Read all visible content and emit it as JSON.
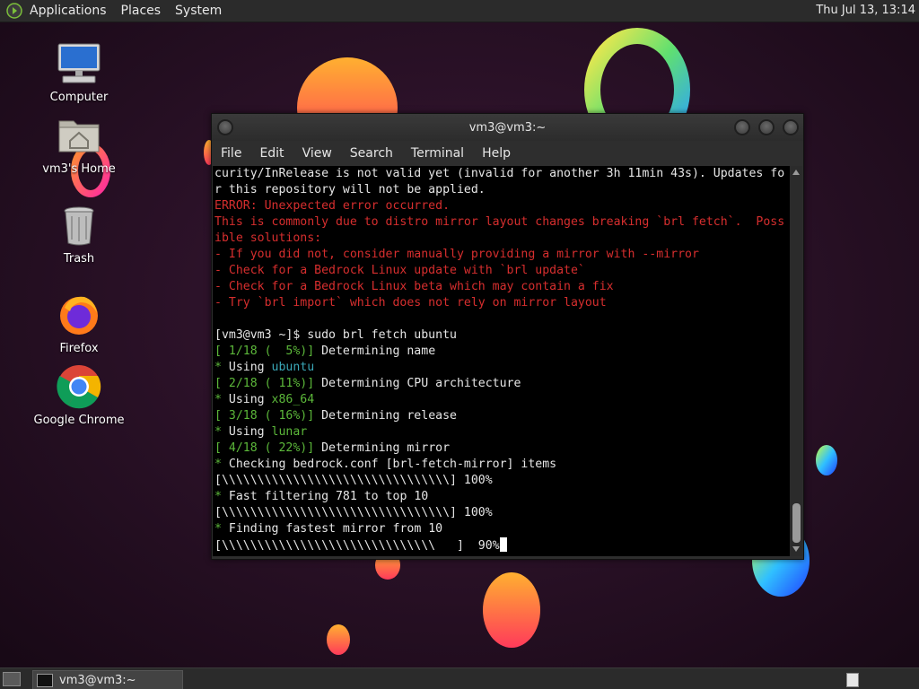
{
  "top_panel": {
    "menus": [
      "Applications",
      "Places",
      "System"
    ],
    "clock": "Thu Jul 13, 13:14"
  },
  "desktop": {
    "icons": [
      {
        "label": "Computer",
        "icon": "computer-icon"
      },
      {
        "label": "vm3's Home",
        "icon": "home-folder-icon"
      },
      {
        "label": "Trash",
        "icon": "trash-icon"
      },
      {
        "label": "Firefox",
        "icon": "firefox-icon"
      },
      {
        "label": "Google Chrome",
        "icon": "chrome-icon"
      }
    ]
  },
  "window": {
    "title": "vm3@vm3:~",
    "menus": [
      "File",
      "Edit",
      "View",
      "Search",
      "Terminal",
      "Help"
    ]
  },
  "terminal": {
    "lines": [
      [
        {
          "t": "curity/InRelease is not valid yet (invalid for another 3h 11min 43s). Updates fo",
          "c": ""
        }
      ],
      [
        {
          "t": "r this repository will not be applied.",
          "c": ""
        }
      ],
      [
        {
          "t": "ERROR: Unexpected error occurred.",
          "c": "red"
        }
      ],
      [
        {
          "t": "This is commonly due to distro mirror layout changes breaking `brl fetch`.  Poss",
          "c": "red"
        }
      ],
      [
        {
          "t": "ible solutions:",
          "c": "red"
        }
      ],
      [
        {
          "t": "- If you did not, consider manually providing a mirror with --mirror",
          "c": "red"
        }
      ],
      [
        {
          "t": "- Check for a Bedrock Linux update with `brl update`",
          "c": "red"
        }
      ],
      [
        {
          "t": "- Check for a Bedrock Linux beta which may contain a fix",
          "c": "red"
        }
      ],
      [
        {
          "t": "- Try `brl import` which does not rely on mirror layout",
          "c": "red"
        }
      ],
      [
        {
          "t": "",
          "c": ""
        }
      ],
      [
        {
          "t": "[vm3@vm3 ~]$ sudo brl fetch ubuntu",
          "c": ""
        }
      ],
      [
        {
          "t": "[ 1/18 (  5%)]",
          "c": "green"
        },
        {
          "t": " Determining name",
          "c": ""
        }
      ],
      [
        {
          "t": "*",
          "c": "green"
        },
        {
          "t": " Using ",
          "c": ""
        },
        {
          "t": "ubuntu",
          "c": "cyan"
        }
      ],
      [
        {
          "t": "[ 2/18 ( 11%)]",
          "c": "green"
        },
        {
          "t": " Determining CPU architecture",
          "c": ""
        }
      ],
      [
        {
          "t": "*",
          "c": "green"
        },
        {
          "t": " Using ",
          "c": ""
        },
        {
          "t": "x86_64",
          "c": "green"
        }
      ],
      [
        {
          "t": "[ 3/18 ( 16%)]",
          "c": "green"
        },
        {
          "t": " Determining release",
          "c": ""
        }
      ],
      [
        {
          "t": "*",
          "c": "green"
        },
        {
          "t": " Using ",
          "c": ""
        },
        {
          "t": "lunar",
          "c": "green"
        }
      ],
      [
        {
          "t": "[ 4/18 ( 22%)]",
          "c": "green"
        },
        {
          "t": " Determining mirror",
          "c": ""
        }
      ],
      [
        {
          "t": "*",
          "c": "green"
        },
        {
          "t": " Checking bedrock.conf [brl-fetch-mirror] items",
          "c": ""
        }
      ],
      [
        {
          "t": "[\\\\\\\\\\\\\\\\\\\\\\\\\\\\\\\\\\\\\\\\\\\\\\\\\\\\\\\\\\\\\\\\] 100%",
          "c": ""
        }
      ],
      [
        {
          "t": "*",
          "c": "green"
        },
        {
          "t": " Fast filtering 781 to top 10",
          "c": ""
        }
      ],
      [
        {
          "t": "[\\\\\\\\\\\\\\\\\\\\\\\\\\\\\\\\\\\\\\\\\\\\\\\\\\\\\\\\\\\\\\\\] 100%",
          "c": ""
        }
      ],
      [
        {
          "t": "*",
          "c": "green"
        },
        {
          "t": " Finding fastest mirror from 10",
          "c": ""
        }
      ],
      [
        {
          "t": "[\\\\\\\\\\\\\\\\\\\\\\\\\\\\\\\\\\\\\\\\\\\\\\\\\\\\\\\\\\\\   ]  90%",
          "c": ""
        }
      ]
    ]
  },
  "bottom_panel": {
    "task_label": "vm3@vm3:~"
  },
  "colors": {
    "error_red": "#d62e2e",
    "ok_green": "#5cb83a",
    "value_cyan": "#3aa8b8"
  }
}
